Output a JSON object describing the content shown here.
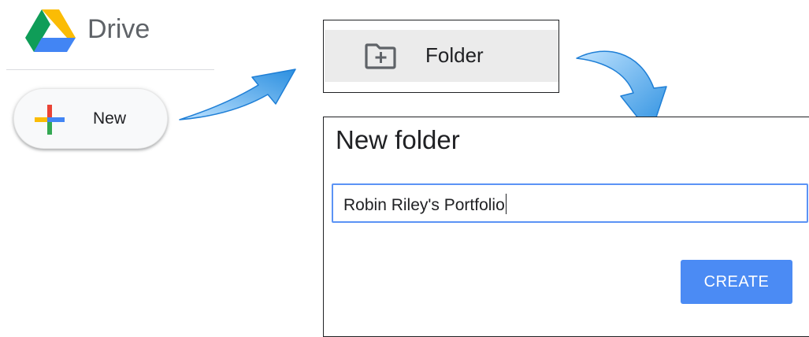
{
  "app": {
    "name": "Drive"
  },
  "new_button": {
    "label": "New"
  },
  "menu": {
    "folder_label": "Folder"
  },
  "dialog": {
    "title": "New folder",
    "input_value": "Robin Riley's Portfolio",
    "create_label": "CREATE"
  },
  "icons": {
    "logo": "google-drive-logo",
    "new": "multicolor-plus-icon",
    "folder": "new-folder-icon",
    "arrows": [
      "curved-arrow-right-icon",
      "curved-arrow-down-icon"
    ]
  },
  "colors": {
    "accent_blue": "#4b8bf4",
    "input_border": "#5b93f5",
    "menu_highlight": "#ebebeb",
    "arrow_blue": "#3fa0e8"
  }
}
